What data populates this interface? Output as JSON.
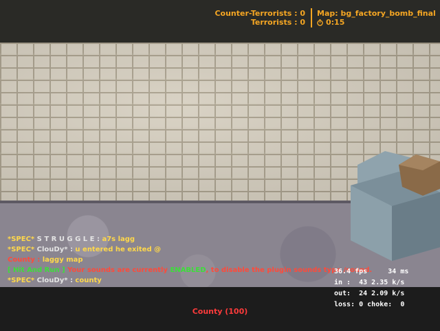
{
  "scoreboard": {
    "ct_label": "Counter-Terrorists : 0",
    "t_label": "Terrorists : 0",
    "map_label": "Map: bg_factory_bomb_final",
    "timer": "0:15"
  },
  "chat": {
    "line1": {
      "prefix": "*SPEC*",
      "name": " S T R U G G L E :",
      "message": " a7s lagg"
    },
    "line2": {
      "prefix": "*SPEC*",
      "name": " ClouDy* :",
      "message": "  u entered he exited @"
    },
    "line3": {
      "name": "County :",
      "message": "  laggy map"
    },
    "line4": {
      "part1": "[ Hit And Run ]",
      "part2": " Your sounds are currently ",
      "part3": "ENABLED",
      "part4": ", to disable the plugin sounds type /sound."
    },
    "line5": {
      "prefix": "*SPEC*",
      "name": " ClouDy* :",
      "message": "  county"
    }
  },
  "netgraph": {
    "fps": "36.4 fps     34 ms",
    "in": "in :  43 2.35 k/s",
    "out": "out:  24 2.09 k/s",
    "loss": "loss: 0 choke:  0"
  },
  "player": {
    "health_label": "County (100)"
  },
  "colors": {
    "hud_orange": "#f5a623",
    "chat_yellow": "#ffd84a",
    "chat_red": "#ff4a3a",
    "chat_green": "#3dde3a",
    "health_red": "#ff3b3b"
  },
  "icons": {
    "timer": "stopwatch-icon"
  }
}
